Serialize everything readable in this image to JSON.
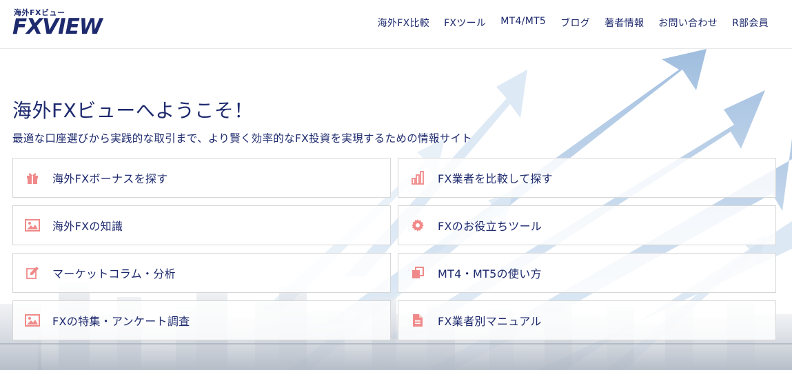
{
  "logo": {
    "sub": "海外FXビュー",
    "main": "FXVIEW"
  },
  "nav": [
    {
      "label": "海外FX比較"
    },
    {
      "label": "FXツール"
    },
    {
      "label": "MT4/MT5"
    },
    {
      "label": "ブログ"
    },
    {
      "label": "著者情報"
    },
    {
      "label": "お問い合わせ"
    },
    {
      "label": "R部会員"
    }
  ],
  "hero": {
    "title": "海外FXビューへようこそ！",
    "subtitle": "最適な口座選びから実践的な取引まで、より賢く効率的なFX投資を実現するための情報サイト"
  },
  "cards": [
    {
      "label": "海外FXボーナスを探す",
      "icon": "gift-icon"
    },
    {
      "label": "FX業者を比較して探す",
      "icon": "bar-chart-icon"
    },
    {
      "label": "海外FXの知識",
      "icon": "image-icon"
    },
    {
      "label": "FXのお役立ちツール",
      "icon": "gear-icon"
    },
    {
      "label": "マーケットコラム・分析",
      "icon": "edit-icon"
    },
    {
      "label": "MT4・MT5の使い方",
      "icon": "copy-icon"
    },
    {
      "label": "FXの特集・アンケート調査",
      "icon": "image-icon"
    },
    {
      "label": "FX業者別マニュアル",
      "icon": "document-icon"
    }
  ],
  "colors": {
    "brand": "#1e2a6e",
    "icon_accent": "#f08a8a",
    "arrow": "#9dbde0"
  }
}
